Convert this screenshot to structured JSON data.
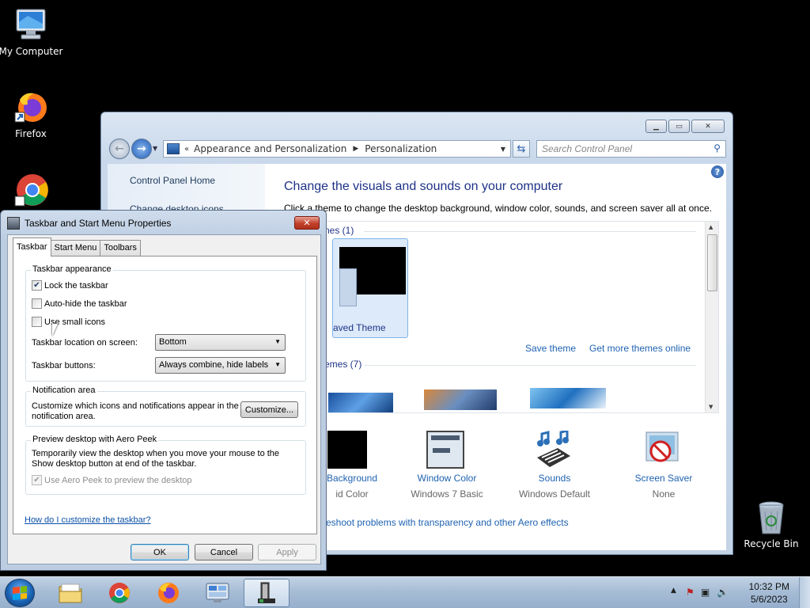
{
  "desktop": {
    "icons": [
      {
        "label": "My Computer"
      },
      {
        "label": "Firefox"
      },
      {
        "label": "Recycle Bin"
      }
    ]
  },
  "control_panel": {
    "breadcrumb": [
      "Appearance and Personalization",
      "Personalization"
    ],
    "search_placeholder": "Search Control Panel",
    "left_links": [
      "Control Panel Home",
      "Change desktop icons"
    ],
    "heading": "Change the visuals and sounds on your computer",
    "subheading": "Click a theme to change the desktop background, window color, sounds, and screen saver all at once.",
    "my_themes_label": "My Themes (1)",
    "my_themes_visible": "nes (1)",
    "selected_theme": "Unsaved Theme",
    "selected_theme_visible": "aved Theme",
    "save_theme": "Save theme",
    "get_more": "Get more themes online",
    "aero_themes_visible": "emes (7)",
    "bottom": [
      {
        "title": "Desktop Background",
        "title_visible": "Background",
        "subtitle_visible": "id Color"
      },
      {
        "title": "Window Color",
        "subtitle": "Windows 7 Basic"
      },
      {
        "title": "Sounds",
        "subtitle": "Windows Default"
      },
      {
        "title": "Screen Saver",
        "subtitle": "None"
      }
    ],
    "troubleshoot_visible": "eshoot problems with transparency and other Aero effects"
  },
  "dialog": {
    "title": "Taskbar and Start Menu Properties",
    "tabs": [
      "Taskbar",
      "Start Menu",
      "Toolbars"
    ],
    "appearance": {
      "legend": "Taskbar appearance",
      "lock": {
        "label": "Lock the taskbar",
        "checked": true
      },
      "autohide": {
        "label": "Auto-hide the taskbar",
        "checked": false
      },
      "small_icons": {
        "label": "Use small icons",
        "checked": false
      },
      "location_label": "Taskbar location on screen:",
      "location_value": "Bottom",
      "buttons_label": "Taskbar buttons:",
      "buttons_value": "Always combine, hide labels"
    },
    "notification": {
      "legend": "Notification area",
      "text": "Customize which icons and notifications appear in the notification area.",
      "text_line1": "Customize which icons and notifications appear in the",
      "text_line2": "notification area.",
      "button": "Customize..."
    },
    "peek": {
      "legend": "Preview desktop with Aero Peek",
      "text_line1": "Temporarily view the desktop when you move your mouse to the",
      "text_line2": "Show desktop button at end of the taskbar.",
      "checkbox": "Use Aero Peek to preview the desktop"
    },
    "help_link": "How do I customize the taskbar?",
    "buttons": {
      "ok": "OK",
      "cancel": "Cancel",
      "apply": "Apply"
    }
  },
  "taskbar": {
    "clock_time": "10:32 PM",
    "clock_date": "5/6/2023"
  }
}
